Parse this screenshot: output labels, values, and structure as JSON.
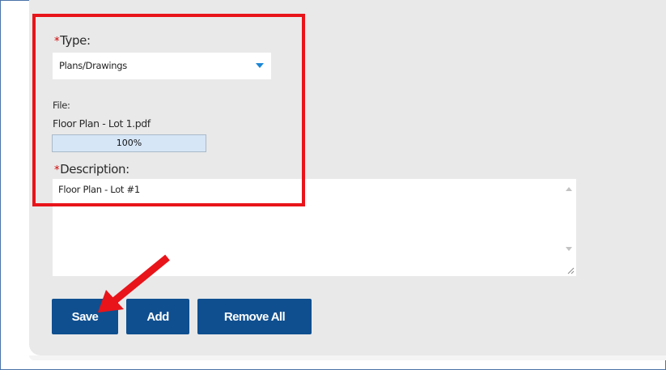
{
  "form": {
    "type": {
      "required_marker": "*",
      "label": "Type:",
      "selected_value": "Plans/Drawings"
    },
    "file": {
      "label": "File:",
      "name": "Floor Plan - Lot 1.pdf",
      "progress_percent": 100,
      "progress_text": "100%"
    },
    "description": {
      "required_marker": "*",
      "label": "Description:",
      "value": "Floor Plan - Lot #1"
    }
  },
  "buttons": {
    "save": "Save",
    "add": "Add",
    "remove_all": "Remove All"
  },
  "annotation": {
    "highlight_color": "#e8141a",
    "arrow_color": "#e8141a",
    "points_to": "save-button"
  },
  "colors": {
    "button_bg": "#0f4f8f",
    "panel_bg": "#e9e9e9",
    "caret": "#1b86d6",
    "required": "#d10000",
    "progress_fill": "#d6e6f7"
  }
}
